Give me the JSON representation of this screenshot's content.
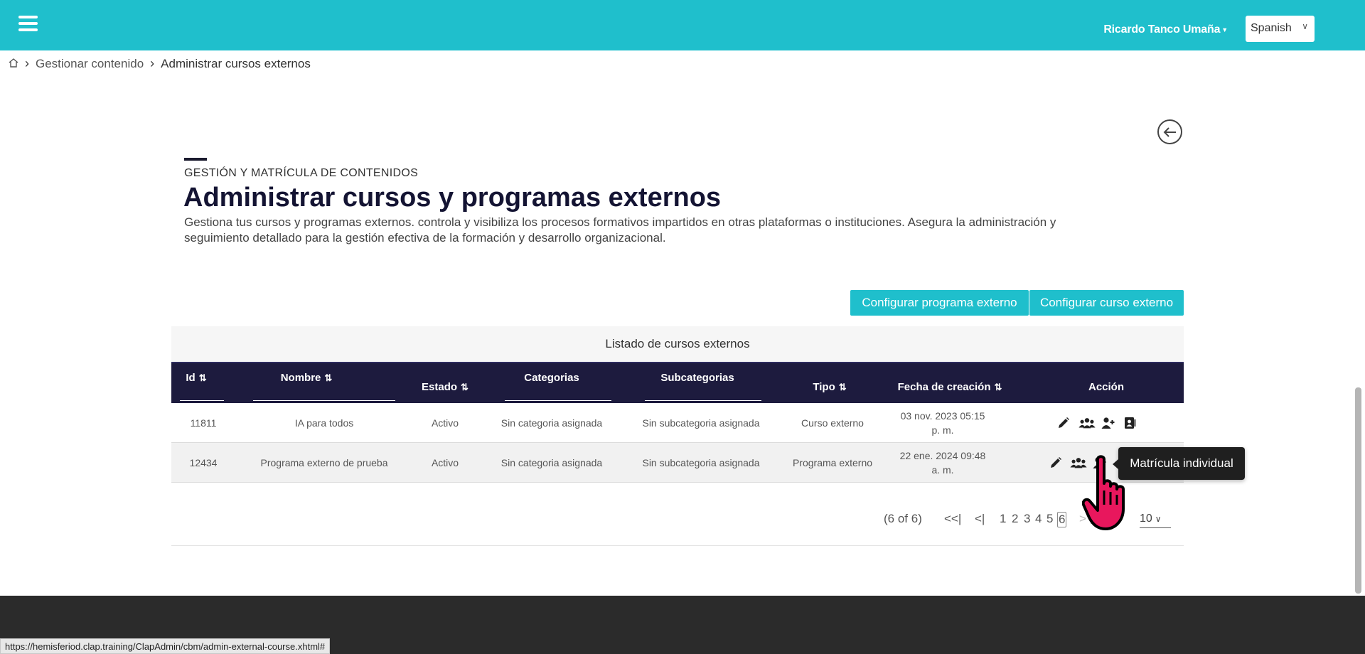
{
  "header": {
    "user_name": "Ricardo Tanco Umaña",
    "language": "Spanish",
    "bg_color": "#1fbfcc"
  },
  "breadcrumb": {
    "items": [
      "Gestionar contenido",
      "Administrar cursos externos"
    ]
  },
  "page": {
    "kicker": "GESTIÓN Y MATRÍCULA DE CONTENIDOS",
    "title": "Administrar cursos y programas externos",
    "description": "Gestiona tus cursos y programas externos. controla y visibiliza los procesos formativos impartidos en otras plataformas o instituciones. Asegura la administración y seguimiento detallado para la gestión efectiva de la formación y desarrollo organizacional."
  },
  "toolbar": {
    "config_program_label": "Configurar programa externo",
    "config_course_label": "Configurar curso externo"
  },
  "table": {
    "caption": "Listado de cursos externos",
    "columns": {
      "id": "Id",
      "name": "Nombre",
      "status": "Estado",
      "categories": "Categorias",
      "subcategories": "Subcategorias",
      "type": "Tipo",
      "created": "Fecha de creación",
      "action": "Acción"
    },
    "rows": [
      {
        "id": "11811",
        "name": "IA para todos",
        "status": "Activo",
        "category": "Sin categoria asignada",
        "subcategory": "Sin subcategoria asignada",
        "type": "Curso externo",
        "created": "03 nov. 2023 05:15 p. m."
      },
      {
        "id": "12434",
        "name": "Programa externo de prueba",
        "status": "Activo",
        "category": "Sin categoria asignada",
        "subcategory": "Sin subcategoria asignada",
        "type": "Programa externo",
        "created": "22 ene. 2024 09:48 a. m."
      }
    ],
    "header_color": "#1d1b3e"
  },
  "tooltip": {
    "text": "Matrícula individual"
  },
  "pagination": {
    "report": "(6 of 6)",
    "pages": [
      "1",
      "2",
      "3",
      "4",
      "5",
      "6"
    ],
    "current_page": "6",
    "rows_per_page": "10"
  },
  "status_bar": {
    "url": "https://hemisferiod.clap.training/ClapAdmin/cbm/admin-external-course.xhtml#"
  },
  "icons": [
    "menu-icon",
    "home-icon",
    "chevron-right-icon",
    "arrow-left-icon",
    "sort-icon",
    "pencil-icon",
    "group-icon",
    "user-add-icon",
    "contact-card-icon",
    "first-page-icon",
    "prev-page-icon",
    "next-page-icon",
    "last-page-icon",
    "hand-pointer-icon"
  ]
}
